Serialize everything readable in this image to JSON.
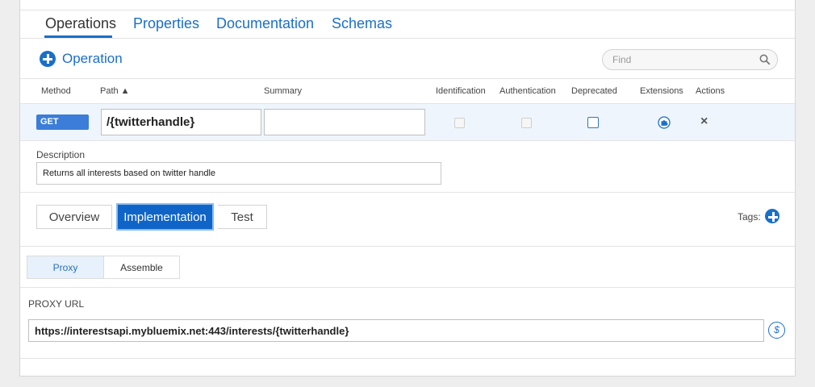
{
  "tabs": [
    {
      "label": "Operations",
      "active": true
    },
    {
      "label": "Properties"
    },
    {
      "label": "Documentation"
    },
    {
      "label": "Schemas"
    }
  ],
  "add_operation_label": "Operation",
  "search": {
    "placeholder": "Find",
    "value": ""
  },
  "columns": {
    "method": "Method",
    "path": "Path ▲",
    "summary": "Summary",
    "identification": "Identification",
    "authentication": "Authentication",
    "deprecated": "Deprecated",
    "extensions": "Extensions",
    "actions": "Actions"
  },
  "operation": {
    "method": "GET",
    "path": "/{twitterhandle}",
    "summary": "",
    "identification": false,
    "authentication": false,
    "deprecated": false,
    "delete_glyph": "×"
  },
  "description": {
    "label": "Description",
    "value": "Returns all interests based on twitter handle"
  },
  "detail_tabs": [
    {
      "label": "Overview"
    },
    {
      "label": "Implementation",
      "active": true
    },
    {
      "label": "Test"
    }
  ],
  "tags_label": "Tags:",
  "impl_tabs": [
    {
      "label": "Proxy",
      "active": true
    },
    {
      "label": "Assemble"
    }
  ],
  "proxy": {
    "label": "PROXY URL",
    "url": "https://interestsapi.mybluemix.net:443/interests/{twitterhandle}"
  },
  "colors": {
    "accent": "#1a6fc9",
    "method_get": "#3b7dd8",
    "active_segment": "#0f64c8",
    "row_highlight": "#eef5fc"
  },
  "icons": {
    "add": "plus-circle-icon",
    "search": "magnifier-icon",
    "extensions": "puzzle-piece-icon",
    "delete": "close-icon",
    "variables": "dollar-icon"
  }
}
